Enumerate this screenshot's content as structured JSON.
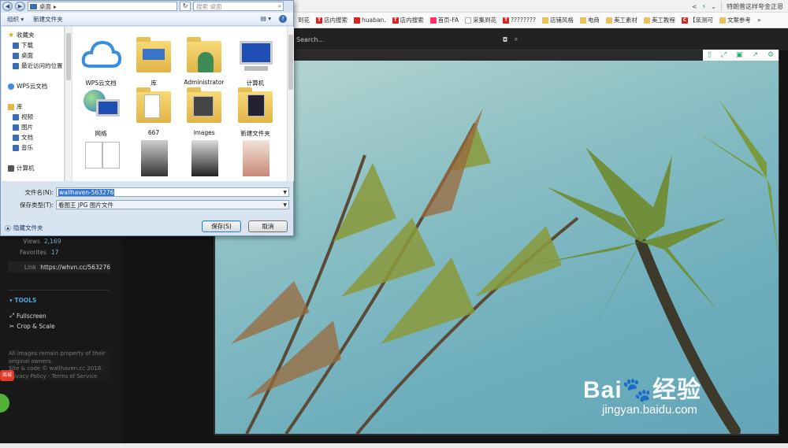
{
  "browser": {
    "right_text": "特朗普这样夸金正恩",
    "bookmarks": [
      "到花",
      "店内搜索",
      "huaban.",
      "店内搜索",
      "首页-FA",
      "采集到花",
      "????????",
      "店铺风格",
      "电商",
      "美工素材",
      "美工教程",
      "【亲测可",
      "文案参考",
      "»"
    ]
  },
  "site": {
    "search_placeholder": "Search...",
    "views_label": "Views",
    "views_value": "2,169",
    "favorites_label": "Favorites",
    "favorites_value": "17",
    "link_label": "Link",
    "link_value": "https://whvn.cc/563276",
    "tools_title": "▾ TOOLS",
    "tool_fullscreen": "Fullscreen",
    "tool_crop": "Crop & Scale",
    "footer_line1": "All images remain property of their",
    "footer_line2": "original owners.",
    "footer_line3": "Site & code © wallhaven.cc 2018.",
    "footer_line4": "Privacy Policy - Terms of Service",
    "badge": "商城"
  },
  "watermark": {
    "brand": "Bai🐾经验",
    "url": "jingyan.baidu.com"
  },
  "dialog": {
    "address": "桌面",
    "search_placeholder": "搜索 桌面",
    "toolbar": {
      "organize": "组织 ▾",
      "new_folder": "新建文件夹"
    },
    "nav": [
      {
        "label": "收藏夹",
        "icon": "star"
      },
      {
        "label": "下载",
        "icon": "blue"
      },
      {
        "label": "桌面",
        "icon": "blue"
      },
      {
        "label": "最近访问的位置",
        "icon": "blue"
      },
      {
        "label": "",
        "icon": ""
      },
      {
        "label": "WPS云文档",
        "icon": "cloud"
      },
      {
        "label": "",
        "icon": ""
      },
      {
        "label": "库",
        "icon": "lib"
      },
      {
        "label": "视频",
        "icon": "blue"
      },
      {
        "label": "图片",
        "icon": "blue"
      },
      {
        "label": "文档",
        "icon": "blue"
      },
      {
        "label": "音乐",
        "icon": "blue"
      },
      {
        "label": "",
        "icon": ""
      },
      {
        "label": "计算机",
        "icon": "pc"
      }
    ],
    "files": [
      "WPS云文档",
      "库",
      "Administrator",
      "计算机",
      "网络",
      "667",
      "images",
      "新建文件夹"
    ],
    "filename_label": "文件名(N):",
    "filename_value": "wallhaven-563276",
    "filetype_label": "保存类型(T):",
    "filetype_value": "看图王 JPG 图片文件",
    "hide_folders": "隐藏文件夹",
    "save": "保存(S)",
    "cancel": "取消"
  },
  "colors": {
    "accent": "#3375d6",
    "site_link": "#6fb4d5",
    "toolbar_icon": "#3aa56f"
  }
}
